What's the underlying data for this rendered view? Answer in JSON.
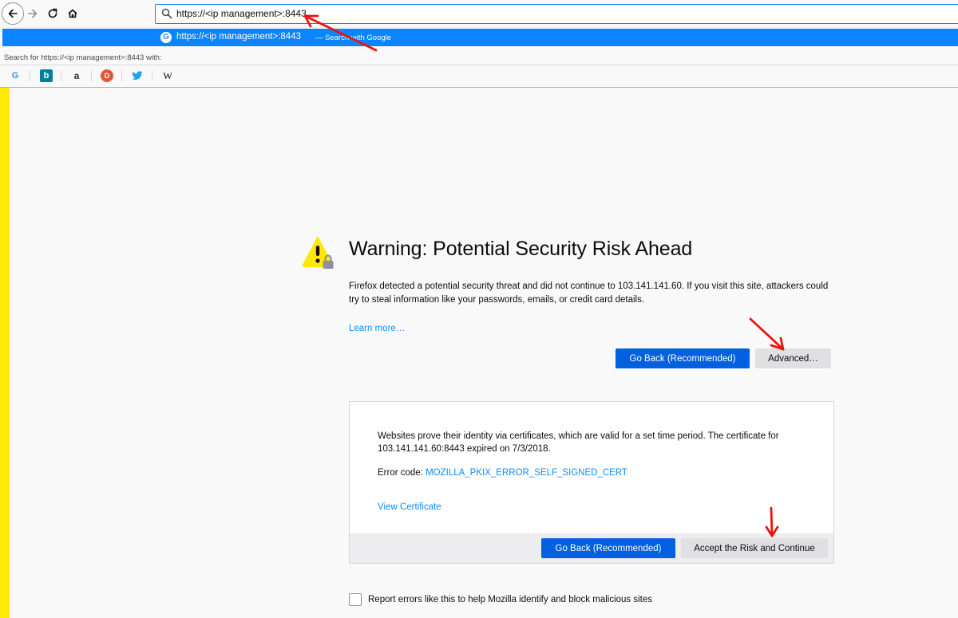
{
  "toolbar": {
    "url": "https://<ip management>:8443"
  },
  "dropdown": {
    "suggestion_url": "https://<ip management>:8443",
    "suggestion_action": "— Search with Google",
    "search_for_text": "Search for https://<ip management>:8443 with:",
    "engines": [
      {
        "name": "google",
        "glyph": "G",
        "color": "#4285f4"
      },
      {
        "name": "bing",
        "glyph": "b",
        "color": "#00809d"
      },
      {
        "name": "amazon",
        "glyph": "a",
        "color": "#232f3e"
      },
      {
        "name": "duckduckgo",
        "glyph": "D",
        "color": "#de5833"
      },
      {
        "name": "twitter",
        "glyph": "t",
        "color": "#1da1f2"
      },
      {
        "name": "wikipedia",
        "glyph": "W",
        "color": "#000000"
      }
    ]
  },
  "page": {
    "title": "Warning: Potential Security Risk Ahead",
    "description": "Firefox detected a potential security threat and did not continue to 103.141.141.60. If you visit this site, attackers could try to steal information like your passwords, emails, or credit card details.",
    "learn_more": "Learn more…",
    "go_back_label": "Go Back (Recommended)",
    "advanced_label": "Advanced…"
  },
  "advanced_panel": {
    "text": "Websites prove their identity via certificates, which are valid for a set time period. The certificate for 103.141.141.60:8443 expired on 7/3/2018.",
    "error_label": "Error code: ",
    "error_code": "MOZILLA_PKIX_ERROR_SELF_SIGNED_CERT",
    "view_certificate": "View Certificate",
    "go_back_label": "Go Back (Recommended)",
    "accept_label": "Accept the Risk and Continue"
  },
  "report": {
    "label": "Report errors like this to help Mozilla identify and block malicious sites",
    "checked": false
  },
  "colors": {
    "accent": "#0a84ff",
    "primary_button": "#0060df",
    "warning_yellow": "#ffe900",
    "annotation_red": "#e8140c"
  }
}
